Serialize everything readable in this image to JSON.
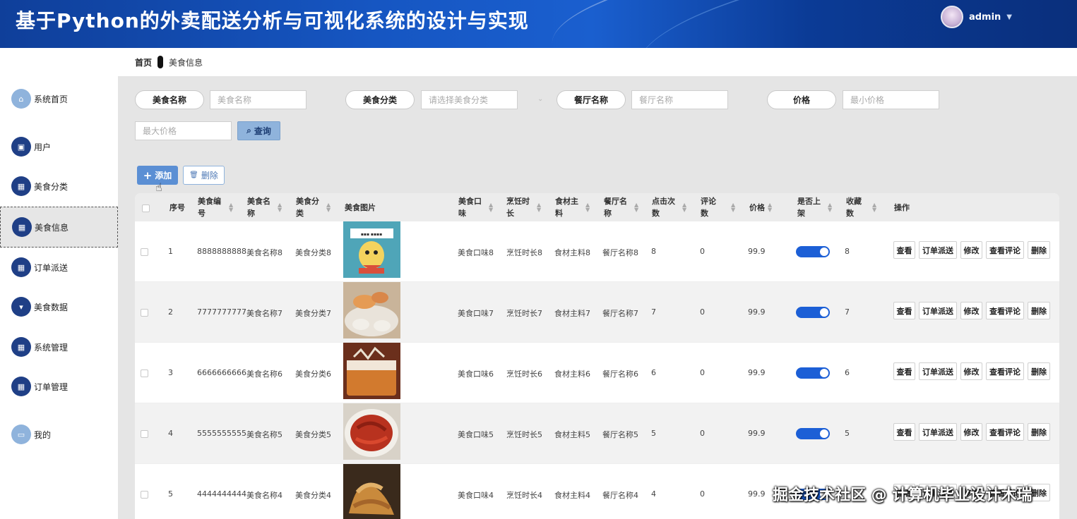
{
  "header": {
    "title": "基于Python的外卖配送分析与可视化系统的设计与实现",
    "username": "admin"
  },
  "sidebar": {
    "items": [
      {
        "label": "系统首页",
        "icon": "home-icon"
      },
      {
        "label": "用户",
        "icon": "user-icon"
      },
      {
        "label": "美食分类",
        "icon": "grid-icon"
      },
      {
        "label": "美食信息",
        "icon": "grid-icon"
      },
      {
        "label": "订单派送",
        "icon": "grid-icon"
      },
      {
        "label": "美食数据",
        "icon": "chart-icon"
      },
      {
        "label": "系统管理",
        "icon": "grid-icon"
      },
      {
        "label": "订单管理",
        "icon": "grid-icon"
      },
      {
        "label": "我的",
        "icon": "profile-icon"
      }
    ],
    "active_label": "美食信息"
  },
  "breadcrumb": {
    "home": "首页",
    "current": "美食信息"
  },
  "search": {
    "food_name_label": "美食名称",
    "food_name_placeholder": "美食名称",
    "category_label": "美食分类",
    "category_placeholder": "请选择美食分类",
    "restaurant_label": "餐厅名称",
    "restaurant_placeholder": "餐厅名称",
    "price_label": "价格",
    "min_price_placeholder": "最小价格",
    "max_price_placeholder": "最大价格",
    "query_label": "查询"
  },
  "toolbar": {
    "add_label": "添加",
    "delete_label": "删除"
  },
  "table": {
    "headers": {
      "index": "序号",
      "code": "美食编号",
      "name": "美食名称",
      "category": "美食分类",
      "image": "美食图片",
      "taste": "美食口味",
      "cook_time": "烹饪时长",
      "ingredient": "食材主料",
      "restaurant": "餐厅名称",
      "clicks": "点击次数",
      "comments": "评论数",
      "price": "价格",
      "on_shelf": "是否上架",
      "favorites": "收藏数",
      "actions": "操作"
    },
    "actions": {
      "view": "查看",
      "dispatch": "订单派送",
      "edit": "修改",
      "view_comments": "查看评论",
      "delete": "删除"
    },
    "rows": [
      {
        "index": "1",
        "code": "8888888888",
        "name": "美食名称8",
        "category": "美食分类8",
        "taste": "美食口味8",
        "cook_time": "烹饪时长8",
        "ingredient": "食材主料8",
        "restaurant": "餐厅名称8",
        "clicks": "8",
        "comments": "0",
        "price": "99.9",
        "on_shelf": true,
        "favorites": "8"
      },
      {
        "index": "2",
        "code": "7777777777",
        "name": "美食名称7",
        "category": "美食分类7",
        "taste": "美食口味7",
        "cook_time": "烹饪时长7",
        "ingredient": "食材主料7",
        "restaurant": "餐厅名称7",
        "clicks": "7",
        "comments": "0",
        "price": "99.9",
        "on_shelf": true,
        "favorites": "7"
      },
      {
        "index": "3",
        "code": "6666666666",
        "name": "美食名称6",
        "category": "美食分类6",
        "taste": "美食口味6",
        "cook_time": "烹饪时长6",
        "ingredient": "食材主料6",
        "restaurant": "餐厅名称6",
        "clicks": "6",
        "comments": "0",
        "price": "99.9",
        "on_shelf": true,
        "favorites": "6"
      },
      {
        "index": "4",
        "code": "5555555555",
        "name": "美食名称5",
        "category": "美食分类5",
        "taste": "美食口味5",
        "cook_time": "烹饪时长5",
        "ingredient": "食材主料5",
        "restaurant": "餐厅名称5",
        "clicks": "5",
        "comments": "0",
        "price": "99.9",
        "on_shelf": true,
        "favorites": "5"
      },
      {
        "index": "5",
        "code": "4444444444",
        "name": "美食名称4",
        "category": "美食分类4",
        "taste": "美食口味4",
        "cook_time": "烹饪时长4",
        "ingredient": "食材主料4",
        "restaurant": "餐厅名称4",
        "clicks": "4",
        "comments": "0",
        "price": "99.9",
        "on_shelf": true,
        "favorites": ""
      }
    ]
  },
  "watermark": "掘金技术社区 @ 计算机毕业设计木瑞",
  "colors": {
    "header_blue": "#1656c2",
    "nav_icon": "#1f3f86",
    "toggle_on": "#1c5fd6",
    "add_button": "#5b8fd4"
  }
}
